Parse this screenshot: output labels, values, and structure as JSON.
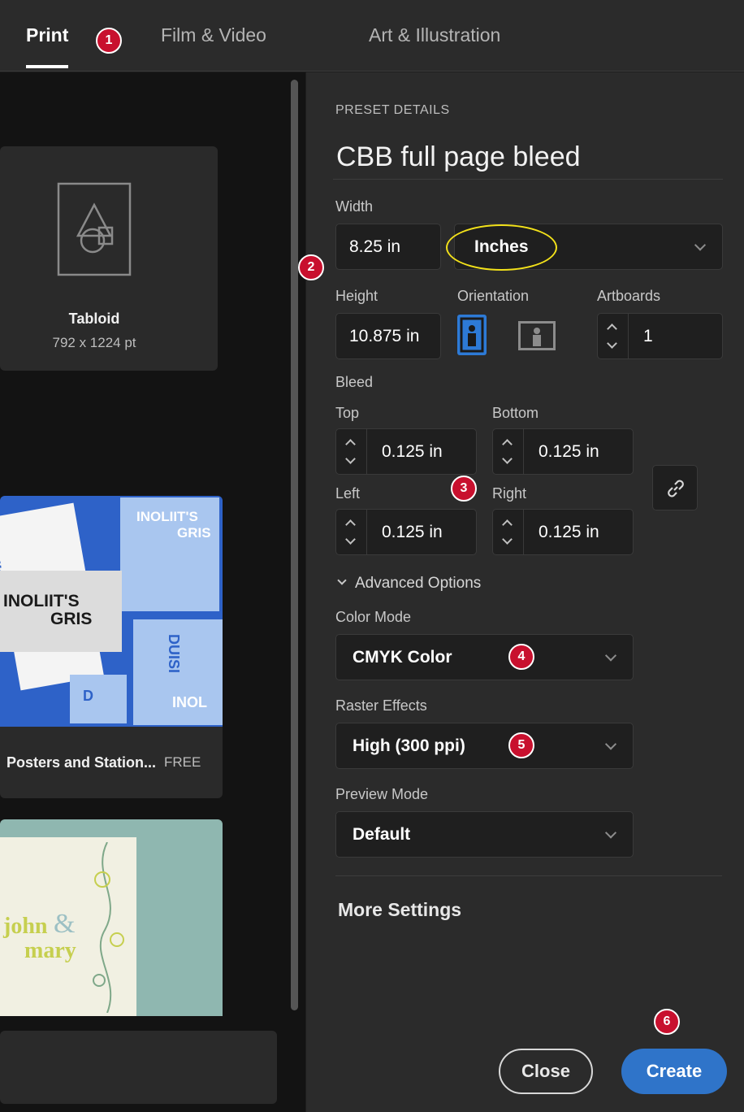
{
  "tabs": [
    {
      "label": "Print",
      "active": true
    },
    {
      "label": "Film & Video",
      "active": false
    },
    {
      "label": "Art & Illustration",
      "active": false
    }
  ],
  "left": {
    "tabloid": {
      "name": "Tabloid",
      "size": "792 x 1224 pt"
    },
    "template1": {
      "title": "Posters and Station...",
      "price": "FREE",
      "poster_texts": [
        "DUISI",
        "INOLIIT'S",
        "GRIS",
        "INOLIIT'S",
        "GRIS",
        "DUISI",
        "INOL",
        "D"
      ]
    },
    "template2": {
      "names": [
        "john",
        "&",
        "mary"
      ]
    }
  },
  "preset": {
    "section_label": "PRESET DETAILS",
    "name": "CBB full page bleed",
    "width_label": "Width",
    "width_value": "8.25 in",
    "units_value": "Inches",
    "height_label": "Height",
    "height_value": "10.875 in",
    "orientation_label": "Orientation",
    "artboards_label": "Artboards",
    "artboards_value": "1",
    "bleed_label": "Bleed",
    "bleed_top_label": "Top",
    "bleed_top_value": "0.125 in",
    "bleed_bottom_label": "Bottom",
    "bleed_bottom_value": "0.125 in",
    "bleed_left_label": "Left",
    "bleed_left_value": "0.125 in",
    "bleed_right_label": "Right",
    "bleed_right_value": "0.125 in",
    "advanced_label": "Advanced Options",
    "color_mode_label": "Color Mode",
    "color_mode_value": "CMYK Color",
    "raster_label": "Raster Effects",
    "raster_value": "High (300 ppi)",
    "preview_label": "Preview Mode",
    "preview_value": "Default",
    "more_settings": "More Settings"
  },
  "buttons": {
    "close": "Close",
    "create": "Create"
  },
  "badges": [
    "1",
    "2",
    "3",
    "4",
    "5",
    "6"
  ],
  "colors": {
    "accent": "#2d7ad6",
    "create_button": "#2f74c9",
    "badge": "#c8102e",
    "highlight_ellipse": "#f2e11a",
    "panel": "#2b2b2b",
    "field": "#1f1f1f"
  },
  "icons": [
    "portrait-orientation-icon",
    "landscape-orientation-icon",
    "link-icon",
    "chevron-down-icon",
    "document-shapes-icon"
  ]
}
